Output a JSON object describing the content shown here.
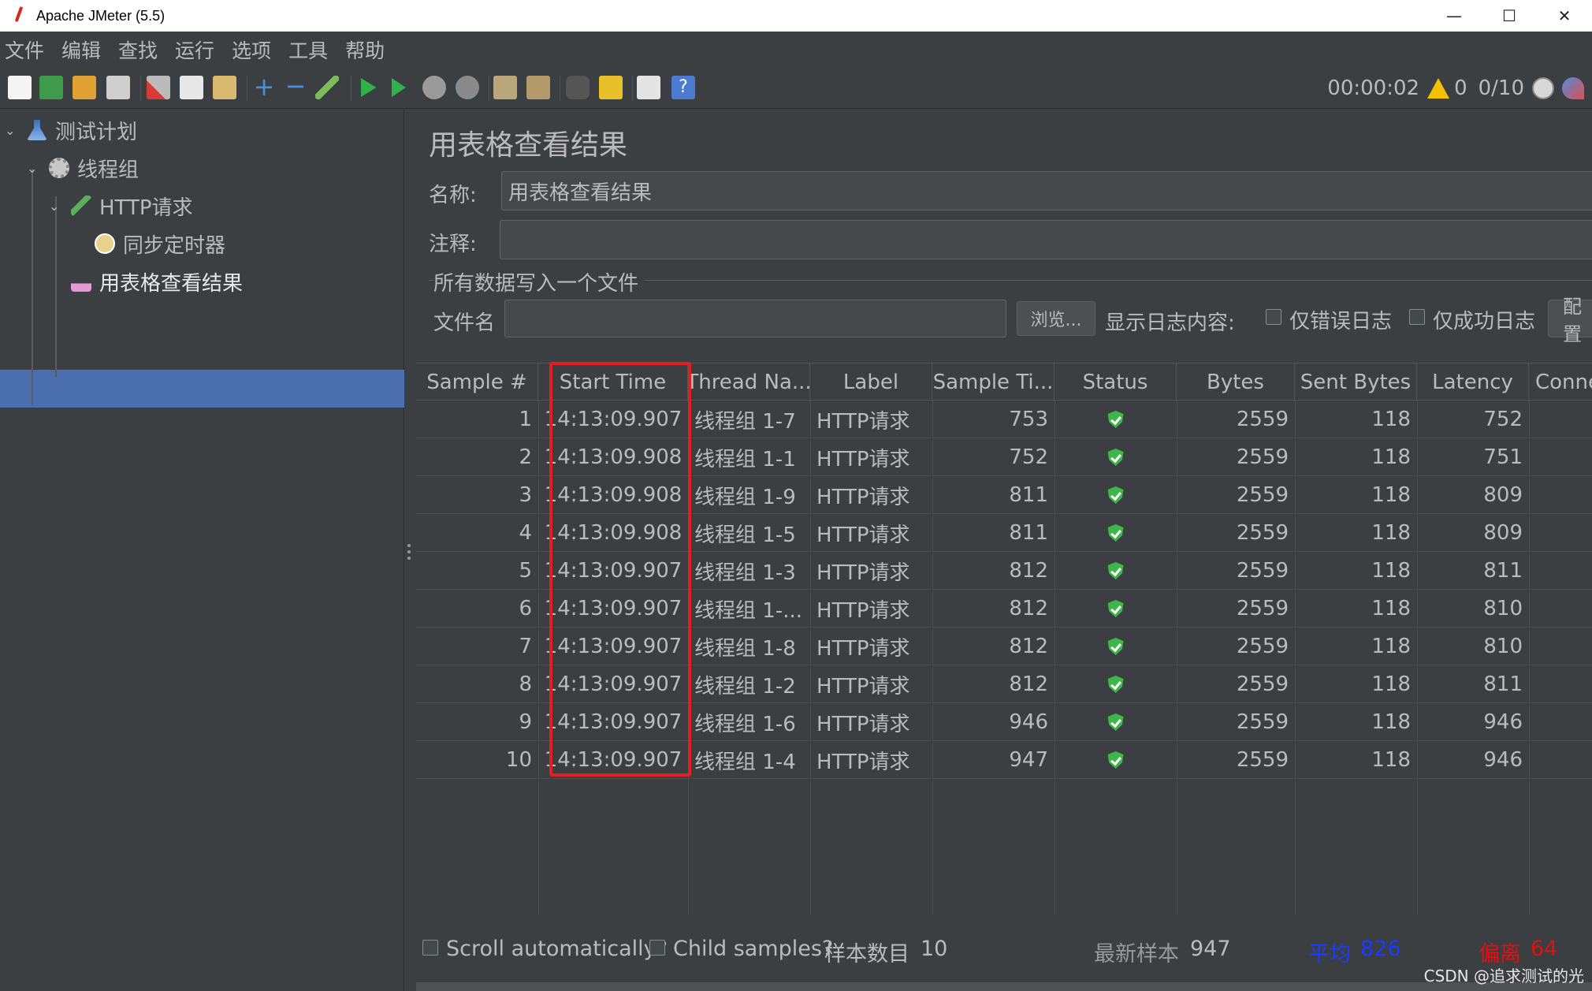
{
  "window": {
    "title": "Apache JMeter (5.5)",
    "min": "—",
    "max": "☐",
    "close": "✕"
  },
  "menu": [
    "文件",
    "编辑",
    "查找",
    "运行",
    "选项",
    "工具",
    "帮助"
  ],
  "toolbar": {
    "elapsed": "00:00:02",
    "warnings": "0",
    "threads": "0/10"
  },
  "tree": {
    "items": [
      {
        "label": "测试计划",
        "icon": "test-plan-icon"
      },
      {
        "label": "线程组",
        "icon": "gear-icon"
      },
      {
        "label": "HTTP请求",
        "icon": "pipette-icon"
      },
      {
        "label": "同步定时器",
        "icon": "timer-icon"
      },
      {
        "label": "用表格查看结果",
        "icon": "chart-icon"
      }
    ]
  },
  "panel": {
    "title": "用表格查看结果",
    "name_label": "名称:",
    "name_value": "用表格查看结果",
    "comment_label": "注释:",
    "comment_value": "",
    "section_label": "所有数据写入一个文件",
    "file_label": "文件名",
    "file_value": "",
    "browse_label": "浏览...",
    "log_label": "显示日志内容:",
    "errors_only": "仅错误日志",
    "success_only": "仅成功日志",
    "config_label": "配置"
  },
  "table": {
    "headers": [
      "Sample #",
      "Start Time",
      "Thread Na...",
      "Label",
      "Sample Ti...",
      "Status",
      "Bytes",
      "Sent Bytes",
      "Latency",
      "Conne"
    ],
    "rows": [
      [
        "1",
        "14:13:09.907",
        "线程组 1-7",
        "HTTP请求",
        "753",
        "ok",
        "2559",
        "118",
        "752"
      ],
      [
        "2",
        "14:13:09.908",
        "线程组 1-1",
        "HTTP请求",
        "752",
        "ok",
        "2559",
        "118",
        "751"
      ],
      [
        "3",
        "14:13:09.908",
        "线程组 1-9",
        "HTTP请求",
        "811",
        "ok",
        "2559",
        "118",
        "809"
      ],
      [
        "4",
        "14:13:09.908",
        "线程组 1-5",
        "HTTP请求",
        "811",
        "ok",
        "2559",
        "118",
        "809"
      ],
      [
        "5",
        "14:13:09.907",
        "线程组 1-3",
        "HTTP请求",
        "812",
        "ok",
        "2559",
        "118",
        "811"
      ],
      [
        "6",
        "14:13:09.907",
        "线程组 1-...",
        "HTTP请求",
        "812",
        "ok",
        "2559",
        "118",
        "810"
      ],
      [
        "7",
        "14:13:09.907",
        "线程组 1-8",
        "HTTP请求",
        "812",
        "ok",
        "2559",
        "118",
        "810"
      ],
      [
        "8",
        "14:13:09.907",
        "线程组 1-2",
        "HTTP请求",
        "812",
        "ok",
        "2559",
        "118",
        "811"
      ],
      [
        "9",
        "14:13:09.907",
        "线程组 1-6",
        "HTTP请求",
        "946",
        "ok",
        "2559",
        "118",
        "946"
      ],
      [
        "10",
        "14:13:09.907",
        "线程组 1-4",
        "HTTP请求",
        "947",
        "ok",
        "2559",
        "118",
        "946"
      ]
    ]
  },
  "footer": {
    "scroll_auto": "Scroll automatically?",
    "child_samples": "Child samples?",
    "sample_count_label": "样本数目",
    "sample_count": "10",
    "latest_label": "最新样本",
    "latest": "947",
    "avg_label": "平均",
    "avg": "826",
    "dev_label": "偏离",
    "dev": "64",
    "avg_color": "#1a3cff",
    "dev_color": "#e01010"
  },
  "watermark": "CSDN @追求测试的光"
}
